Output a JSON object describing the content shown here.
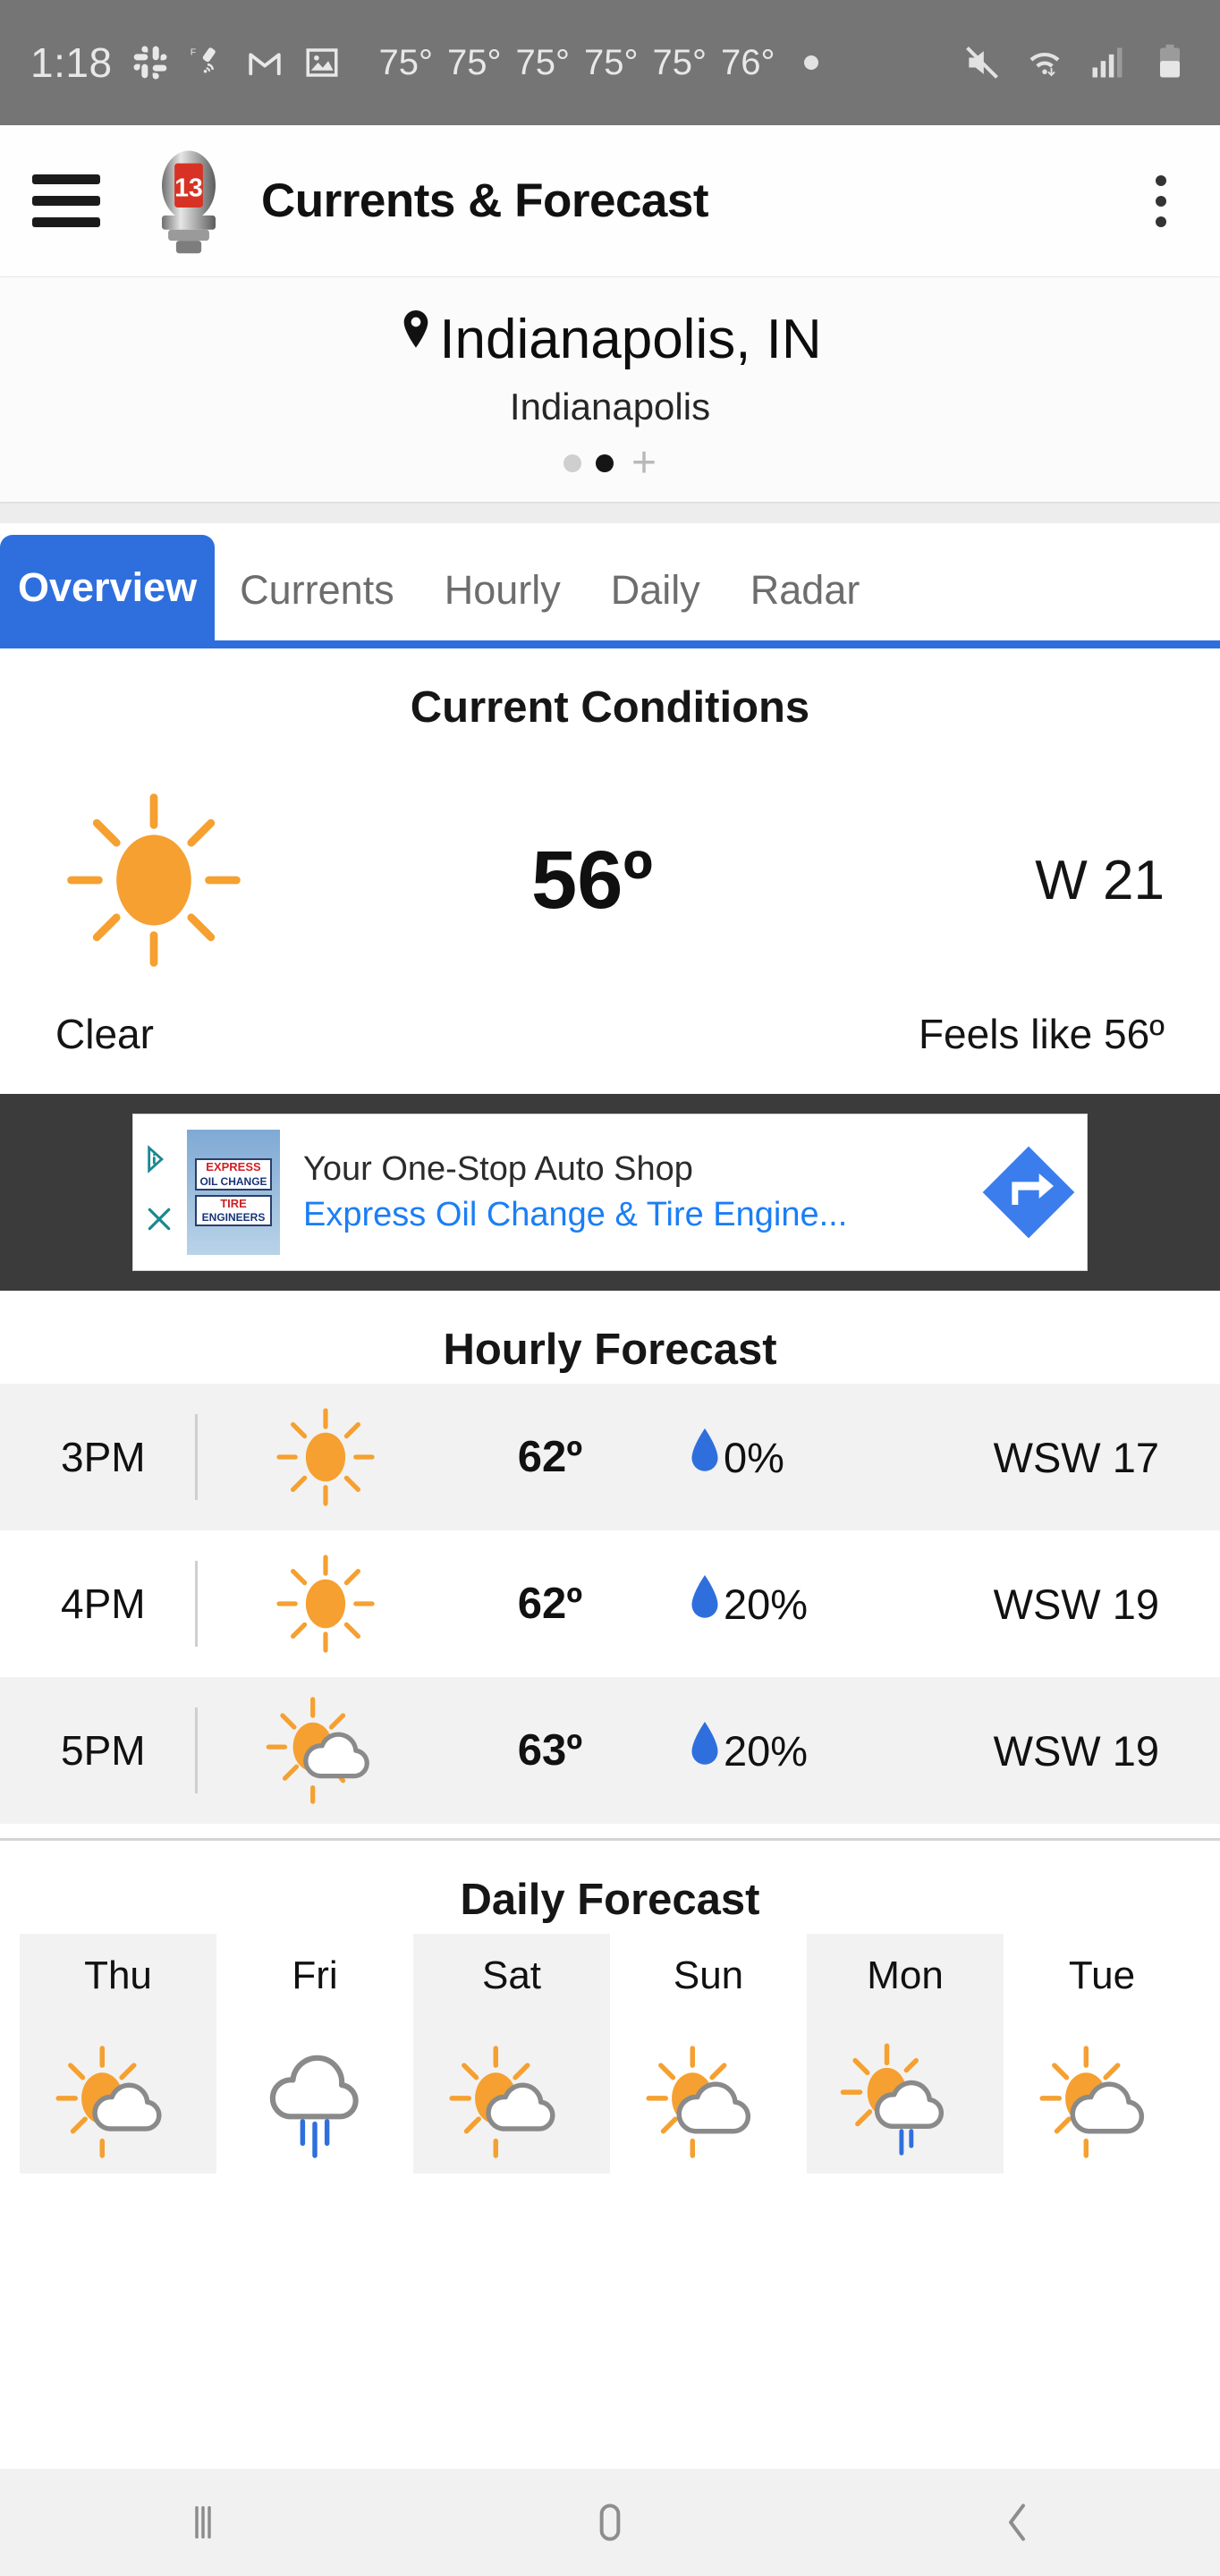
{
  "status_bar": {
    "time": "1:18",
    "icons_left": [
      "slack-icon",
      "satellite-icon",
      "gmail-icon",
      "photo-icon"
    ],
    "temperatures": [
      "75°",
      "75°",
      "75°",
      "75°",
      "75°",
      "76°"
    ],
    "icons_right": [
      "mute-icon",
      "wifi-icon",
      "signal-icon",
      "battery-icon"
    ],
    "background": "#757575"
  },
  "appbar": {
    "menu_icon": "hamburger-icon",
    "logo": "channel-13-rocket-logo",
    "logo_number": "13",
    "title": "Currents & Forecast",
    "overflow_icon": "kebab-menu-icon"
  },
  "location": {
    "pin_icon": "location-pin-icon",
    "city_state": "Indianapolis, IN",
    "station": "Indianapolis",
    "pager": {
      "dots": 2,
      "active_index": 1,
      "add_label": "+"
    }
  },
  "tabs": {
    "active_index": 0,
    "items": [
      {
        "label": "Overview"
      },
      {
        "label": "Currents"
      },
      {
        "label": "Hourly"
      },
      {
        "label": "Daily"
      },
      {
        "label": "Radar"
      }
    ],
    "accent": "#2f6fdd"
  },
  "current_conditions": {
    "title": "Current Conditions",
    "icon": "sunny-icon",
    "temperature": "56º",
    "wind": "W  21",
    "condition": "Clear",
    "feels_like": "Feels like 56º"
  },
  "ad": {
    "info_icon": "adchoices-icon",
    "close_icon": "close-icon",
    "thumbnail": "express-oil-change-sign",
    "sign_line1": "EXPRESS",
    "sign_line2": "OIL CHANGE",
    "sign_line3": "TIRE",
    "sign_line4": "ENGINEERS",
    "headline": "Your One-Stop Auto Shop",
    "link": "Express Oil Change & Tire Engine...",
    "cta_icon": "directions-arrow-icon",
    "background": "#3b3b3b"
  },
  "hourly": {
    "title": "Hourly Forecast",
    "rows": [
      {
        "time": "3PM",
        "icon": "sunny-icon",
        "temp": "62º",
        "precip": "0%",
        "wind": "WSW 17",
        "shaded": true
      },
      {
        "time": "4PM",
        "icon": "sunny-icon",
        "temp": "62º",
        "precip": "20%",
        "wind": "WSW 19",
        "shaded": false
      },
      {
        "time": "5PM",
        "icon": "partly-cloudy-icon",
        "temp": "63º",
        "precip": "20%",
        "wind": "WSW 19",
        "shaded": true
      }
    ],
    "precip_icon": "water-drop-icon",
    "precip_color": "#2f6fdd"
  },
  "daily": {
    "title": "Daily Forecast",
    "days": [
      {
        "name": "Thu",
        "icon": "partly-cloudy-icon",
        "shaded": true
      },
      {
        "name": "Fri",
        "icon": "rain-cloud-icon",
        "shaded": false
      },
      {
        "name": "Sat",
        "icon": "partly-cloudy-icon",
        "shaded": true
      },
      {
        "name": "Sun",
        "icon": "partly-cloudy-icon",
        "shaded": false
      },
      {
        "name": "Mon",
        "icon": "partly-cloudy-rain-icon",
        "shaded": true
      },
      {
        "name": "Tue",
        "icon": "partly-cloudy-icon",
        "shaded": false
      }
    ]
  },
  "navbar": {
    "recents_icon": "recents-icon",
    "home_icon": "home-icon",
    "back_icon": "back-icon"
  },
  "colors": {
    "sun": "#f5a030",
    "cloud_stroke": "#8a8a8a",
    "rain": "#2f6fdd",
    "accent": "#2f6fdd"
  }
}
